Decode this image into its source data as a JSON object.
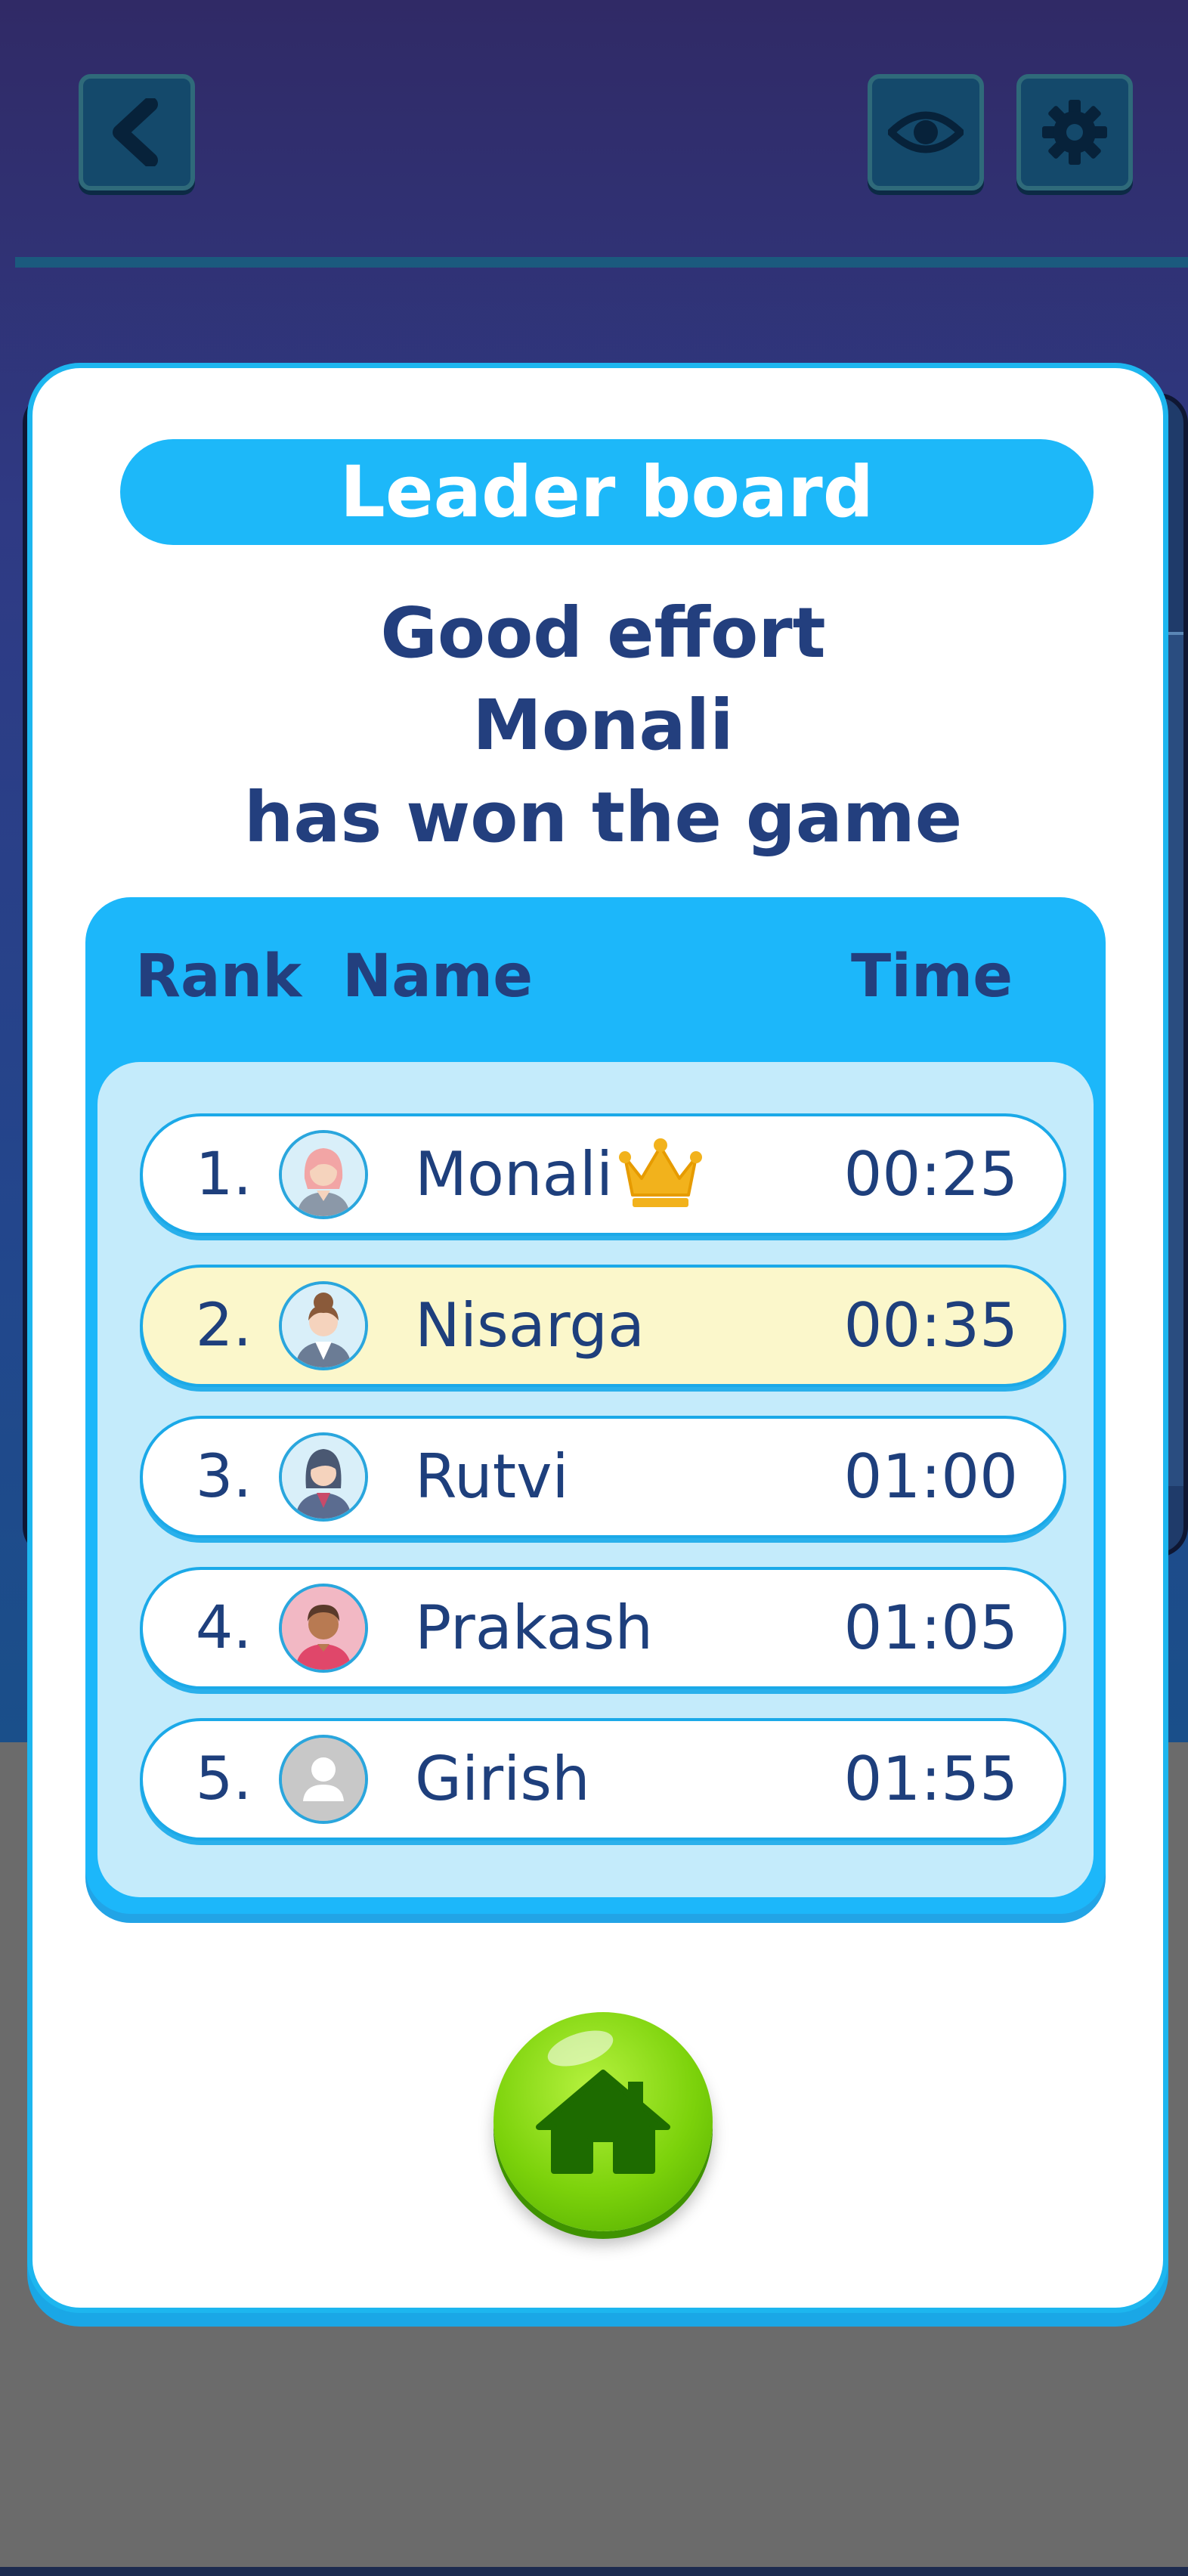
{
  "leaderboard": {
    "title": "Leader board",
    "headline": {
      "line1": "Good effort",
      "line2": "Monali",
      "line3": "has won the game"
    },
    "columns": {
      "rank": "Rank",
      "name": "Name",
      "time": "Time"
    },
    "rows": [
      {
        "rank": "1.",
        "name": "Monali",
        "time": "00:25",
        "winner": true
      },
      {
        "rank": "2.",
        "name": "Nisarga",
        "time": "00:35",
        "highlighted": true
      },
      {
        "rank": "3.",
        "name": "Rutvi",
        "time": "01:00"
      },
      {
        "rank": "4.",
        "name": "Prakash",
        "time": "01:05"
      },
      {
        "rank": "5.",
        "name": "Girish",
        "time": "01:55"
      }
    ]
  },
  "icons": {
    "back": "chevron-left-icon",
    "view": "eye-icon",
    "settings": "gear-icon",
    "winner": "crown-icon",
    "home": "home-icon"
  },
  "colors": {
    "accent": "#1db8f9",
    "text": "#233f7e",
    "highlight_row": "#fbf7cb",
    "home_button": "#7cd20b",
    "crown": "#f2b21c"
  }
}
